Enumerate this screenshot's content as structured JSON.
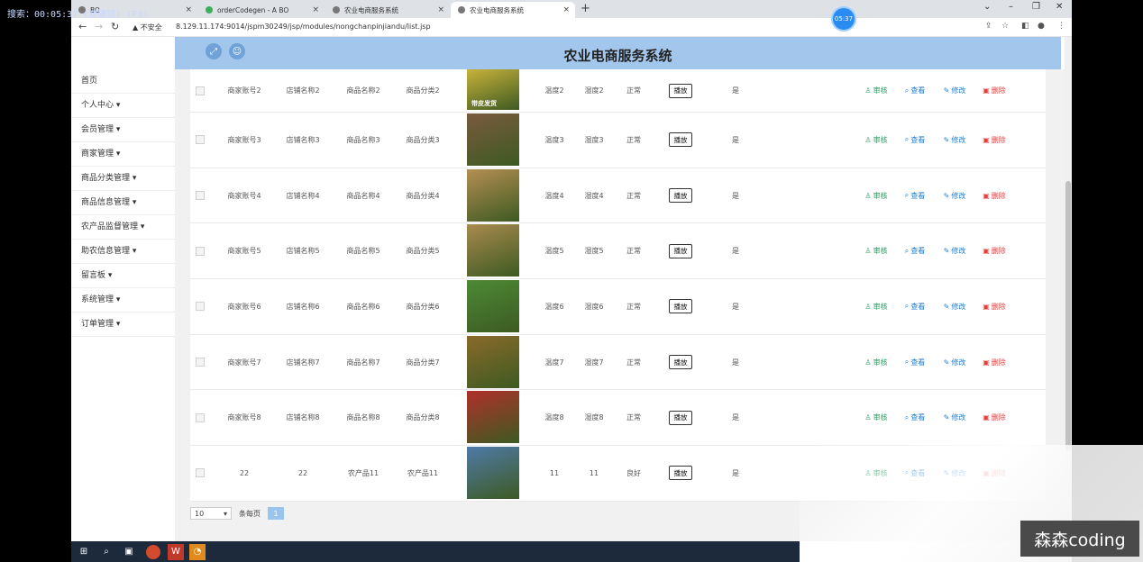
{
  "overlay": {
    "text": "搜索：00:05:37 (快捷键) (F3)"
  },
  "browser": {
    "tabs": [
      {
        "label": "BO"
      },
      {
        "label": "orderCodegen - A BO"
      },
      {
        "label": "农业电商服务系统"
      },
      {
        "label": "农业电商服务系统"
      }
    ],
    "new_tab": "+",
    "timer": "05:37",
    "security": "不安全",
    "url": "8.129.11.174:9014/jspm30249/jsp/modules/nongchanpinjiandu/list.jsp"
  },
  "header": {
    "title": "农业电商服务系统"
  },
  "sidebar": {
    "items": [
      {
        "label": "首页"
      },
      {
        "label": "个人中心 ▾"
      },
      {
        "label": "会员管理 ▾"
      },
      {
        "label": "商家管理 ▾"
      },
      {
        "label": "商品分类管理 ▾"
      },
      {
        "label": "商品信息管理 ▾"
      },
      {
        "label": "农产品监督管理 ▾"
      },
      {
        "label": "助农信息管理 ▾"
      },
      {
        "label": "留言板 ▾"
      },
      {
        "label": "系统管理 ▾"
      },
      {
        "label": "订单管理 ▾"
      }
    ]
  },
  "actions": {
    "shenhe": "审核",
    "chakan": "查看",
    "xiugai": "修改",
    "shanchu": "删除",
    "play": "播放"
  },
  "table": {
    "rows": [
      {
        "account": "商家账号2",
        "shop": "店铺名称2",
        "name": "商品名称2",
        "category": "商品分类2",
        "temp": "温度2",
        "humidity": "湿度2",
        "status": "正常",
        "flag": "是",
        "img_color": "#c9b23a",
        "img_caption": "带皮发货"
      },
      {
        "account": "商家账号3",
        "shop": "店铺名称3",
        "name": "商品名称3",
        "category": "商品分类3",
        "temp": "温度3",
        "humidity": "湿度3",
        "status": "正常",
        "flag": "是",
        "img_color": "#7a5a3e",
        "img_caption": ""
      },
      {
        "account": "商家账号4",
        "shop": "店铺名称4",
        "name": "商品名称4",
        "category": "商品分类4",
        "temp": "温度4",
        "humidity": "湿度4",
        "status": "正常",
        "flag": "是",
        "img_color": "#b58e52",
        "img_caption": ""
      },
      {
        "account": "商家账号5",
        "shop": "店铺名称5",
        "name": "商品名称5",
        "category": "商品分类5",
        "temp": "温度5",
        "humidity": "湿度5",
        "status": "正常",
        "flag": "是",
        "img_color": "#a98a4e",
        "img_caption": ""
      },
      {
        "account": "商家账号6",
        "shop": "店铺名称6",
        "name": "商品名称6",
        "category": "商品分类6",
        "temp": "温度6",
        "humidity": "湿度6",
        "status": "正常",
        "flag": "是",
        "img_color": "#4c8a35",
        "img_caption": ""
      },
      {
        "account": "商家账号7",
        "shop": "店铺名称7",
        "name": "商品名称7",
        "category": "商品分类7",
        "temp": "温度7",
        "humidity": "湿度7",
        "status": "正常",
        "flag": "是",
        "img_color": "#8a6a2a",
        "img_caption": ""
      },
      {
        "account": "商家账号8",
        "shop": "店铺名称8",
        "name": "商品名称8",
        "category": "商品分类8",
        "temp": "温度8",
        "humidity": "湿度8",
        "status": "正常",
        "flag": "是",
        "img_color": "#b0302a",
        "img_caption": ""
      },
      {
        "account": "22",
        "shop": "22",
        "name": "农产品11",
        "category": "农产品11",
        "temp": "11",
        "humidity": "11",
        "status": "良好",
        "flag": "是",
        "img_color": "#4f7aa8",
        "img_caption": ""
      }
    ]
  },
  "pager": {
    "page_size": "10",
    "per_page_label": "条每页",
    "current_page": "1"
  },
  "watermark": {
    "text": "森森coding"
  }
}
